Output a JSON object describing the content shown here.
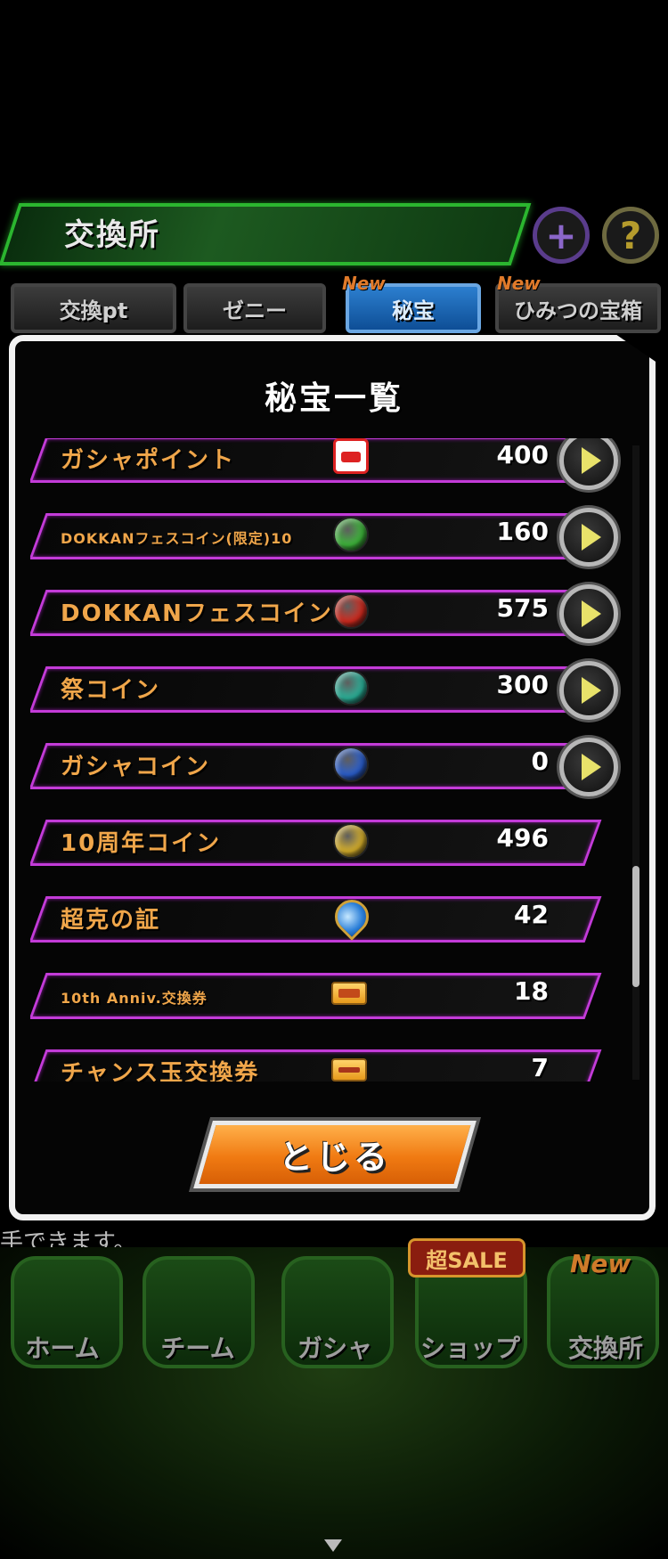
{
  "header": {
    "title": "交換所"
  },
  "tabs": [
    {
      "label": "交換pt",
      "new": false
    },
    {
      "label": "ゼニー",
      "new": false
    },
    {
      "label": "秘宝",
      "new": true,
      "active": true
    },
    {
      "label": "ひみつの宝箱",
      "new": true
    }
  ],
  "tab_new_label": "New",
  "modal": {
    "title": "秘宝一覧",
    "close_label": "とじる",
    "items": [
      {
        "name": "ガシャポイント",
        "value": "400",
        "icon": "gasha-point-ticket-icon",
        "has_arrow": true,
        "small": false
      },
      {
        "name": "DOKKANフェスコイン(限定)10",
        "value": "160",
        "icon": "green-coin-icon",
        "has_arrow": true,
        "small": true,
        "color": "#3db83a"
      },
      {
        "name": "DOKKANフェスコイン",
        "value": "575",
        "icon": "red-coin-icon",
        "has_arrow": true,
        "small": false,
        "color": "#d42a1e"
      },
      {
        "name": "祭コイン",
        "value": "300",
        "icon": "teal-coin-icon",
        "has_arrow": true,
        "small": false,
        "color": "#2ab39a"
      },
      {
        "name": "ガシャコイン",
        "value": "0",
        "icon": "blue-coin-icon",
        "has_arrow": true,
        "small": false,
        "color": "#2a5fd0"
      },
      {
        "name": "10周年コイン",
        "value": "496",
        "icon": "gold-coin-icon",
        "has_arrow": false,
        "small": false,
        "color": "#d9b12a"
      },
      {
        "name": "超克の証",
        "value": "42",
        "icon": "blue-gem-icon",
        "has_arrow": false,
        "small": false
      },
      {
        "name": "10th Anniv.交換券",
        "value": "18",
        "icon": "anniversary-ticket-icon",
        "has_arrow": false,
        "small": true
      },
      {
        "name": "チャンス玉交換券",
        "value": "7",
        "icon": "chance-ticket-icon",
        "has_arrow": false,
        "small": false
      }
    ]
  },
  "hint_text": "手できます。",
  "bottom_nav": [
    {
      "label": "ホーム"
    },
    {
      "label": "チーム"
    },
    {
      "label": "ガシャ"
    },
    {
      "label": "ショップ"
    },
    {
      "label": "交換所"
    }
  ],
  "sale_badge": "超SALE",
  "nav_new_label": "New"
}
